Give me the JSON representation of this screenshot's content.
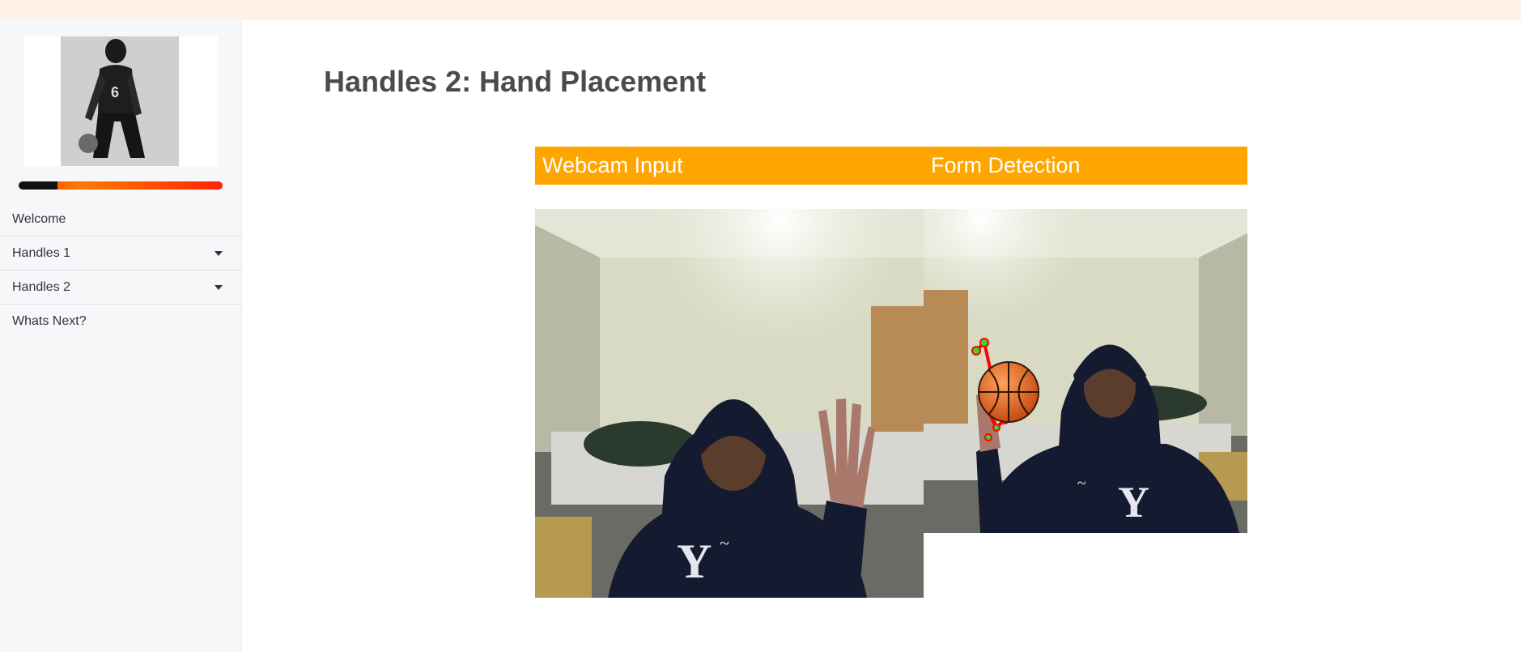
{
  "sidebar": {
    "logo_alt": "basketball player dribbling",
    "progress_value": 0.19,
    "items": [
      {
        "label": "Welcome",
        "has_caret": false
      },
      {
        "label": "Handles 1",
        "has_caret": true
      },
      {
        "label": "Handles 2",
        "has_caret": true
      },
      {
        "label": "Whats Next?",
        "has_caret": false
      }
    ]
  },
  "main": {
    "title": "Handles 2: Hand Placement",
    "columns": [
      "Webcam Input",
      "Form Detection"
    ]
  },
  "colors": {
    "accent": "#ffa500",
    "topbar": "#fdf1e8",
    "sidebar_bg": "#f6f7f9",
    "progress_start": "#111111",
    "progress_end": "#ff2200"
  }
}
